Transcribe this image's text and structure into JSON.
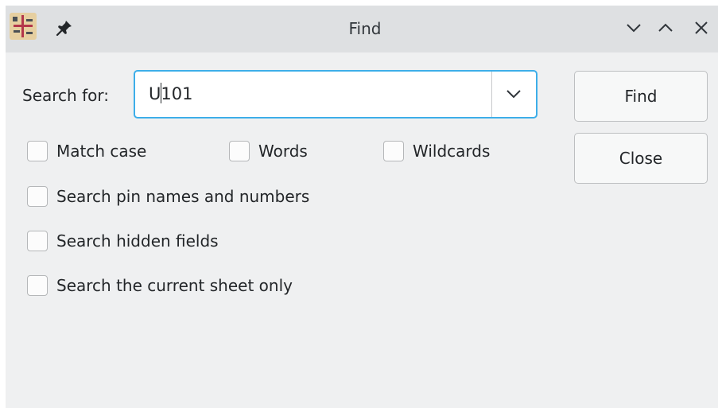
{
  "window": {
    "title": "Find",
    "app_icon": "kicad-schematic-editor-icon",
    "pin_icon": "pin-icon",
    "controls": [
      "minimize-chevron-down-icon",
      "maximize-chevron-up-icon",
      "close-x-icon"
    ]
  },
  "search": {
    "label": "Search for:",
    "value_before_caret": "U",
    "value_after_caret": "101",
    "dropdown_icon": "chevron-down-icon",
    "focus_color": "#3daee9"
  },
  "options": {
    "match_case": {
      "label": "Match case",
      "checked": false
    },
    "words": {
      "label": "Words",
      "checked": false
    },
    "wildcards": {
      "label": "Wildcards",
      "checked": false
    },
    "pin_names": {
      "label": "Search pin names and numbers",
      "checked": false
    },
    "hidden_fields": {
      "label": "Search hidden fields",
      "checked": false
    },
    "current_sheet": {
      "label": "Search the current sheet only",
      "checked": false
    }
  },
  "buttons": {
    "find": "Find",
    "close": "Close"
  }
}
